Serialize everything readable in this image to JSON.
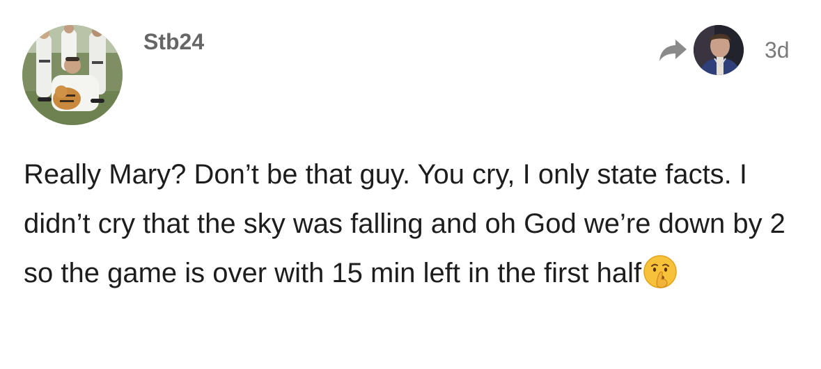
{
  "post": {
    "username": "Stb24",
    "timestamp": "3d",
    "body_text": "Really Mary? Don’t be that guy. You cry, I only state facts. I didn’t cry that the sky was falling and oh God we’re down by 2 so the game is over with 15 min left in the first half",
    "body_emoji": "shushing-face-emoji"
  },
  "icons": {
    "reply_icon": "reply-arrow-icon",
    "reply_icon_color": "#8a8a8a"
  },
  "colors": {
    "username": "#666666",
    "timestamp": "#7a7a7a",
    "body": "#1d1d1d",
    "background": "#ffffff"
  }
}
